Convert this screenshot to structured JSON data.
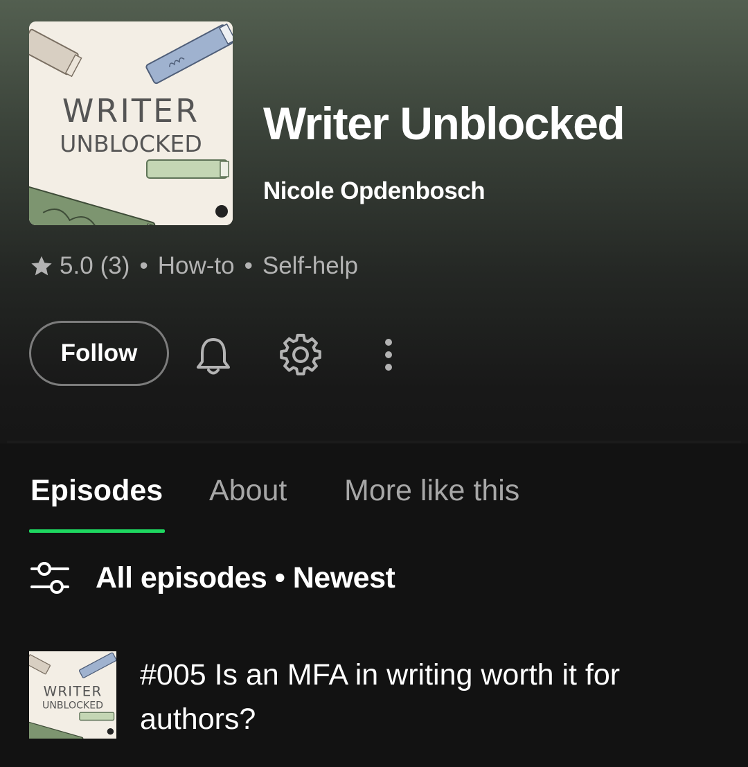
{
  "podcast": {
    "title": "Writer Unblocked",
    "author": "Nicole Opdenbosch",
    "cover_text_line1": "WRITER",
    "cover_text_line2": "UNBLOCKED",
    "rating": "5.0",
    "rating_count": "(3)",
    "separator": "•",
    "category_1": "How-to",
    "category_2": "Self-help"
  },
  "actions": {
    "follow_label": "Follow",
    "icons": [
      "bell-icon",
      "gear-icon",
      "more-vertical-icon"
    ]
  },
  "tabs": [
    {
      "label": "Episodes",
      "active": true
    },
    {
      "label": "About",
      "active": false
    },
    {
      "label": "More like this",
      "active": false
    }
  ],
  "filter": {
    "label": "All episodes • Newest",
    "icon": "sliders-icon"
  },
  "episodes": [
    {
      "title": "#005 Is an MFA in writing worth it for authors?"
    }
  ],
  "colors": {
    "accent": "#1ed760",
    "background": "#121212",
    "hero_top": "#535f50",
    "muted_text": "#b3b3b3",
    "cover_bg": "#f3eee5"
  }
}
